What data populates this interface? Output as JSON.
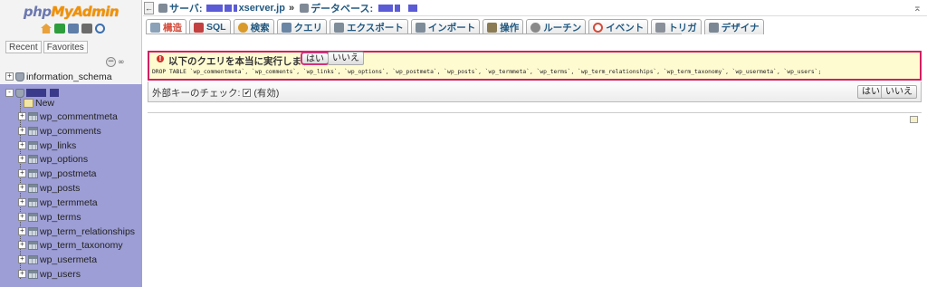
{
  "logo": {
    "php": "php",
    "myadmin": "MyAdmin"
  },
  "sidebar": {
    "tabs": [
      "Recent",
      "Favorites"
    ],
    "databases": [
      {
        "name": "information_schema",
        "expander": "+"
      }
    ],
    "current_db": {
      "expander": "-"
    },
    "tables": [
      "New",
      "wp_commentmeta",
      "wp_comments",
      "wp_links",
      "wp_options",
      "wp_postmeta",
      "wp_posts",
      "wp_termmeta",
      "wp_terms",
      "wp_term_relationships",
      "wp_term_taxonomy",
      "wp_usermeta",
      "wp_users"
    ]
  },
  "breadcrumb": {
    "server_label": "サーバ:",
    "server_suffix": "xserver.jp",
    "sep": "»",
    "db_label": "データベース:"
  },
  "menu_tabs": [
    {
      "label": "構造",
      "active": true,
      "icon": "structure-icon",
      "color": "#8aa1b8"
    },
    {
      "label": "SQL",
      "active": false,
      "icon": "sql-icon",
      "color": "#c24040"
    },
    {
      "label": "検索",
      "active": false,
      "icon": "search-icon",
      "color": "#d99a2b"
    },
    {
      "label": "クエリ",
      "active": false,
      "icon": "query-icon",
      "color": "#6b86a5"
    },
    {
      "label": "エクスポート",
      "active": false,
      "icon": "export-icon",
      "color": "#7e8c99"
    },
    {
      "label": "インポート",
      "active": false,
      "icon": "import-icon",
      "color": "#7e8c99"
    },
    {
      "label": "操作",
      "active": false,
      "icon": "wrench-icon",
      "color": "#8a7b55"
    },
    {
      "label": "ルーチン",
      "active": false,
      "icon": "routine-icon",
      "color": "#8a8a8a"
    },
    {
      "label": "イベント",
      "active": false,
      "icon": "clock-icon",
      "color": "#d34b3a"
    },
    {
      "label": "トリガ",
      "active": false,
      "icon": "trigger-icon",
      "color": "#8a9099"
    },
    {
      "label": "デザイナ",
      "active": false,
      "icon": "designer-icon",
      "color": "#7b8794"
    }
  ],
  "confirm": {
    "question": "以下のクエリを本当に実行しますか?",
    "yes": "はい",
    "no": "いいえ",
    "sql": "DROP TABLE `wp_commentmeta`, `wp_comments`, `wp_links`, `wp_options`, `wp_postmeta`, `wp_posts`, `wp_termmeta`, `wp_terms`, `wp_term_relationships`, `wp_term_taxonomy`, `wp_usermeta`, `wp_users`;"
  },
  "fk": {
    "label": "外部キーのチェック:",
    "check": "✔",
    "enabled": "(有効)",
    "yes": "はい",
    "no": "いいえ"
  }
}
